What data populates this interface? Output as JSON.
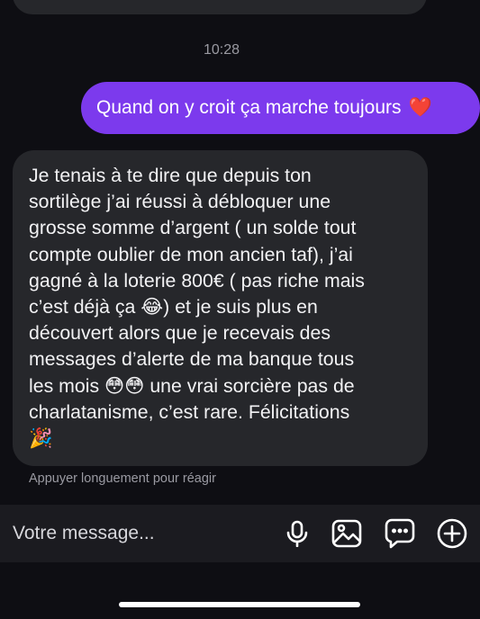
{
  "conversation": {
    "timestamp": "10:28",
    "sent_message": {
      "text": "Quand on y croit ça marche toujours",
      "emoji": "❤️"
    },
    "received_message": {
      "lines": [
        "Je tenais à te dire que depuis ton",
        "sortilège j’ai réussi à débloquer une",
        "grosse somme d’argent ( un solde tout",
        "compte oublier de mon ancien taf), j’ai",
        "gagné à la loterie 800€ ( pas riche mais",
        "c’est déjà ça 😂) et je suis plus en",
        "découvert alors que je recevais des",
        "messages d’alerte de ma banque tous",
        "les mois 😳😳 une vrai sorcière pas de",
        "charlatanisme, c’est rare. Félicitations",
        "🎉"
      ]
    },
    "reaction_hint": "Appuyer longuement pour réagir"
  },
  "composer": {
    "placeholder": "Votre message...",
    "icons": [
      "microphone-icon",
      "image-icon",
      "chat-bubble-icon",
      "plus-circle-icon"
    ]
  },
  "colors": {
    "background": "#0e0e13",
    "sent_bubble": "#7c3aed",
    "received_bubble": "#26272b",
    "composer_bar": "#1b1b20"
  }
}
